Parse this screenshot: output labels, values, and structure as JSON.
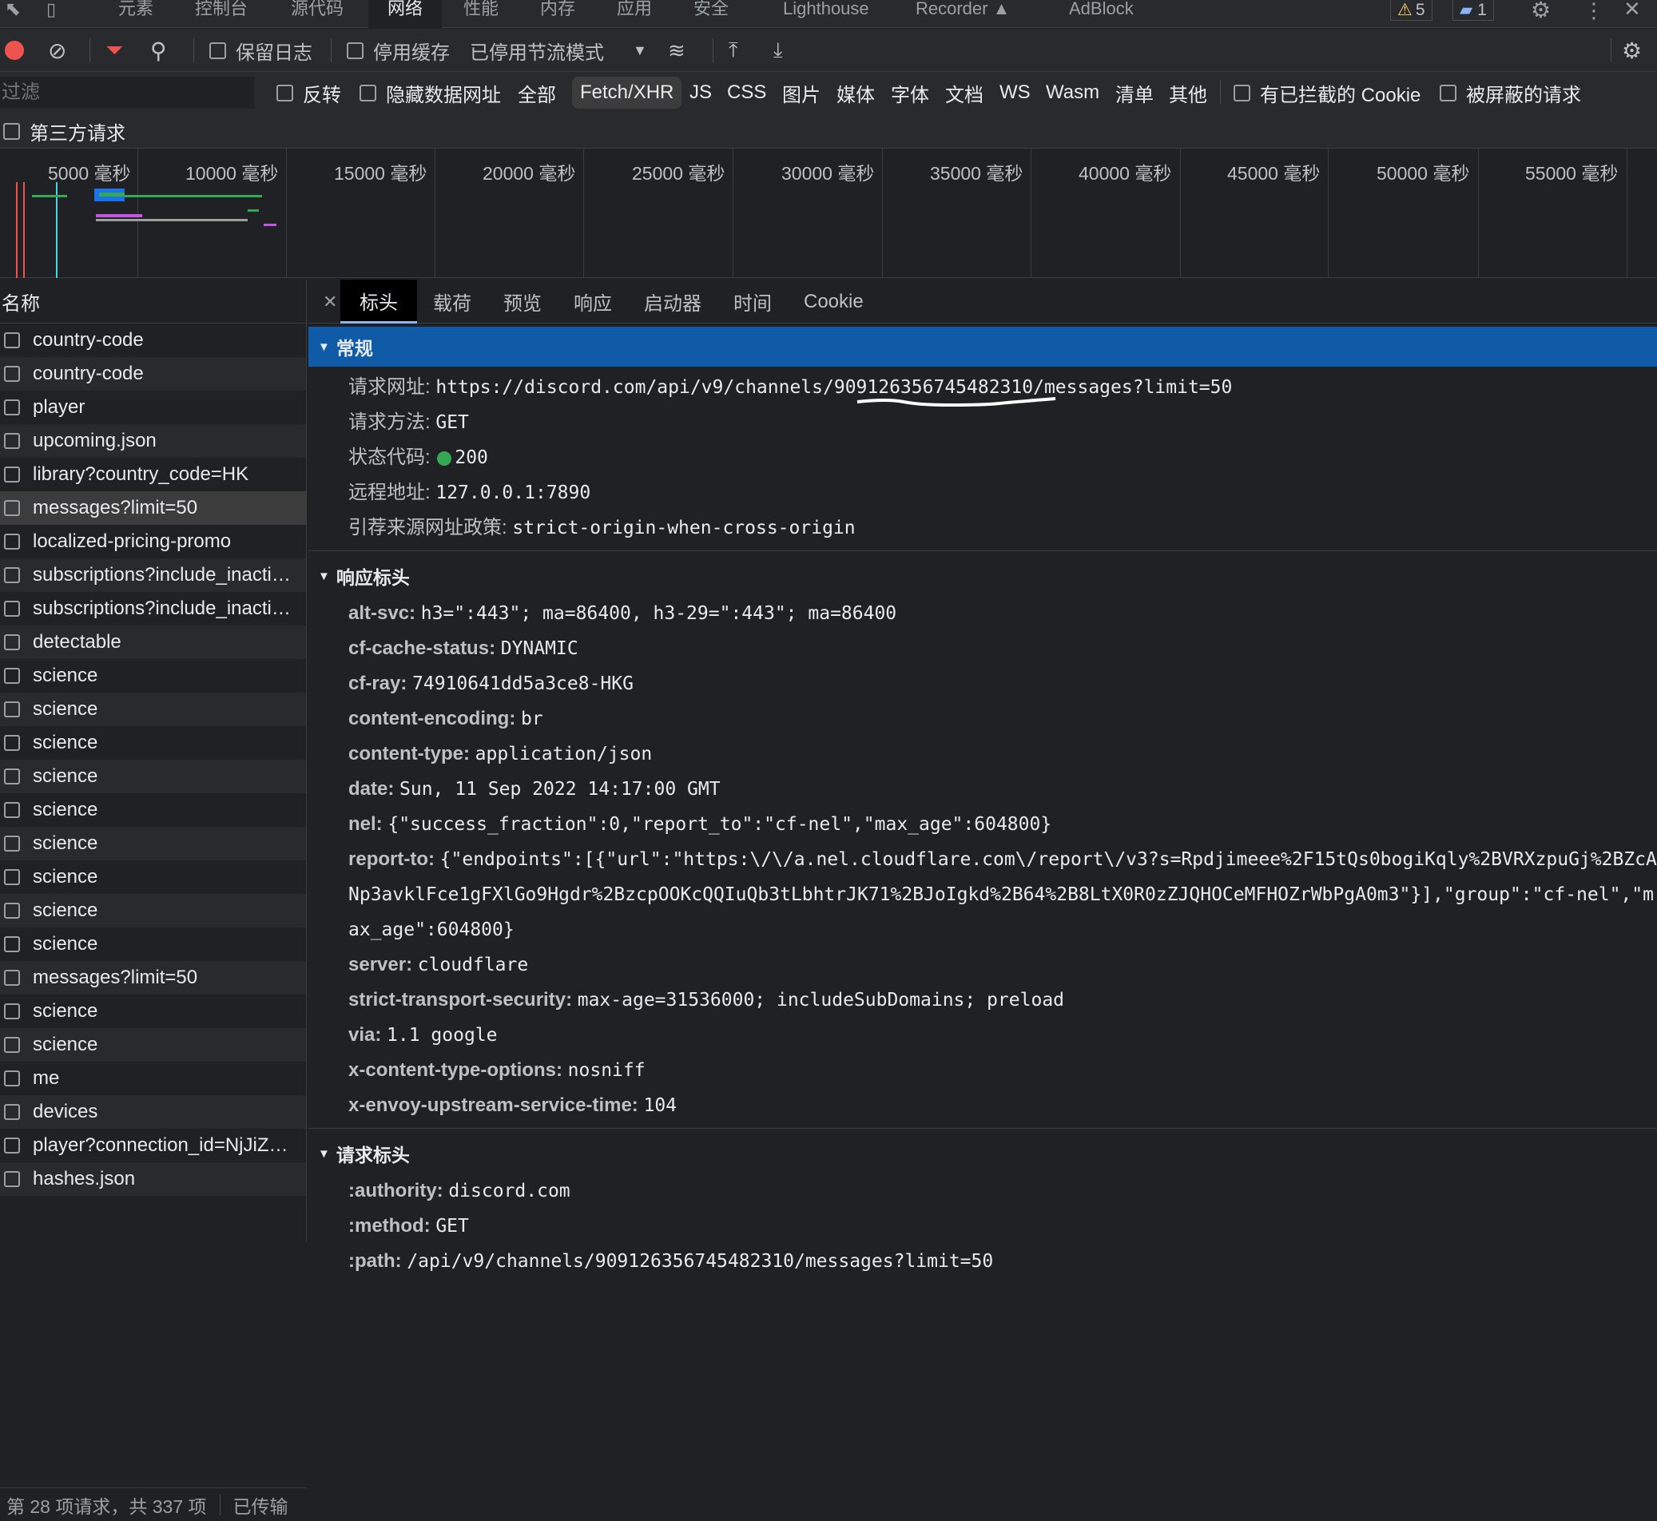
{
  "topbar": {
    "tabs": [
      "元素",
      "控制台",
      "源代码",
      "网络",
      "性能",
      "内存",
      "应用",
      "安全",
      "Lighthouse",
      "Recorder",
      "AdBlock"
    ],
    "warnings_count": "5",
    "messages_count": "1"
  },
  "toolbar": {
    "preserve_log": "保留日志",
    "disable_cache": "停用缓存",
    "throttling": "已停用节流模式"
  },
  "filter": {
    "placeholder": "过滤",
    "invert": "反转",
    "hide_data_urls": "隐藏数据网址",
    "types": [
      "全部",
      "Fetch/XHR",
      "JS",
      "CSS",
      "图片",
      "媒体",
      "字体",
      "文档",
      "WS",
      "Wasm",
      "清单",
      "其他"
    ],
    "blocked_cookies": "有已拦截的 Cookie",
    "blocked_requests": "被屏蔽的请求",
    "third_party": "第三方请求"
  },
  "timeline": {
    "ticks": [
      "5000 毫秒",
      "10000 毫秒",
      "15000 毫秒",
      "20000 毫秒",
      "25000 毫秒",
      "30000 毫秒",
      "35000 毫秒",
      "40000 毫秒",
      "45000 毫秒",
      "50000 毫秒",
      "55000 毫秒"
    ]
  },
  "requests": {
    "header": "名称",
    "items": [
      "country-code",
      "country-code",
      "player",
      "upcoming.json",
      "library?country_code=HK",
      "messages?limit=50",
      "localized-pricing-promo",
      "subscriptions?include_inacti…",
      "subscriptions?include_inacti…",
      "detectable",
      "science",
      "science",
      "science",
      "science",
      "science",
      "science",
      "science",
      "science",
      "science",
      "messages?limit=50",
      "science",
      "science",
      "me",
      "devices",
      "player?connection_id=NjJiZ…",
      "hashes.json"
    ],
    "selected_index": 5,
    "status": "第 28 项请求，共 337 项",
    "status2": "已传输"
  },
  "detail_tabs": [
    "标头",
    "载荷",
    "预览",
    "响应",
    "启动器",
    "时间",
    "Cookie"
  ],
  "general": {
    "title": "常规",
    "rows": [
      {
        "k": "请求网址:",
        "v": "https://discord.com/api/v9/channels/909126356745482310/messages?limit=50"
      },
      {
        "k": "请求方法:",
        "v": "GET"
      },
      {
        "k": "状态代码:",
        "v": "200"
      },
      {
        "k": "远程地址:",
        "v": "127.0.0.1:7890"
      },
      {
        "k": "引荐来源网址政策:",
        "v": "strict-origin-when-cross-origin"
      }
    ]
  },
  "response_headers": {
    "title": "响应标头",
    "rows": [
      {
        "k": "alt-svc:",
        "v": "h3=\":443\"; ma=86400, h3-29=\":443\"; ma=86400"
      },
      {
        "k": "cf-cache-status:",
        "v": "DYNAMIC"
      },
      {
        "k": "cf-ray:",
        "v": "74910641dd5a3ce8-HKG"
      },
      {
        "k": "content-encoding:",
        "v": "br"
      },
      {
        "k": "content-type:",
        "v": "application/json"
      },
      {
        "k": "date:",
        "v": "Sun, 11 Sep 2022 14:17:00 GMT"
      },
      {
        "k": "nel:",
        "v": "{\"success_fraction\":0,\"report_to\":\"cf-nel\",\"max_age\":604800}"
      },
      {
        "k": "report-to:",
        "v": "{\"endpoints\":[{\"url\":\"https:\\/\\/a.nel.cloudflare.com\\/report\\/v3?s=Rpdjimeee%2F15tQs0bogiKqly%2BVRXzpuGj%2BZcANp3avklFce1gFXlGo9Hgdr%2BzcpOOKcQQIuQb3tLbhtrJK71%2BJoIgkd%2B64%2B8LtX0R0zZJQHOCeMFHOZrWbPgA0m3\"}],\"group\":\"cf-nel\",\"max_age\":604800}"
      },
      {
        "k": "server:",
        "v": "cloudflare"
      },
      {
        "k": "strict-transport-security:",
        "v": "max-age=31536000; includeSubDomains; preload"
      },
      {
        "k": "via:",
        "v": "1.1 google"
      },
      {
        "k": "x-content-type-options:",
        "v": "nosniff"
      },
      {
        "k": "x-envoy-upstream-service-time:",
        "v": "104"
      }
    ]
  },
  "request_headers": {
    "title": "请求标头",
    "rows": [
      {
        "k": ":authority:",
        "v": "discord.com"
      },
      {
        "k": ":method:",
        "v": "GET"
      },
      {
        "k": ":path:",
        "v": "/api/v9/channels/909126356745482310/messages?limit=50"
      }
    ]
  },
  "colors": {
    "accent": "#8ab4f8",
    "section_highlight": "#0f5ba7",
    "status_ok": "#34a853",
    "record": "#ef5350"
  }
}
